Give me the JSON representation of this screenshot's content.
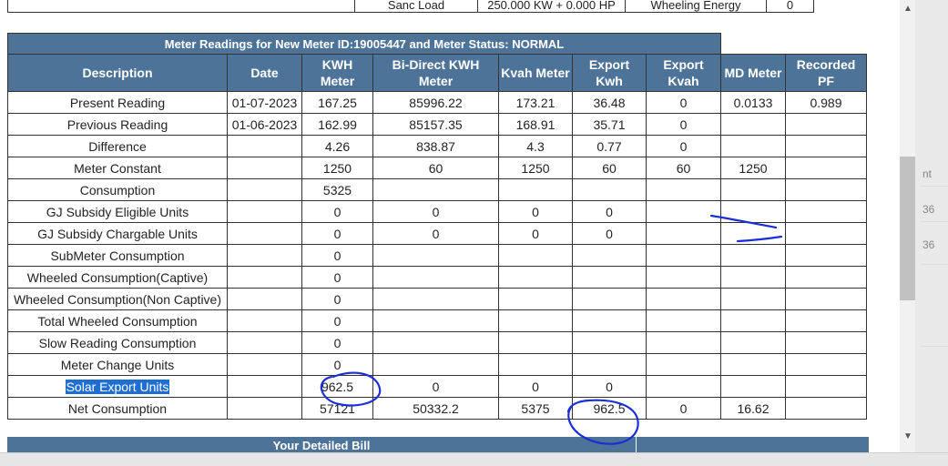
{
  "top_strip": {
    "label1": "Sanc Load",
    "value1": "250.000 KW + 0.000 HP",
    "label2": "Wheeling Energy",
    "value2": "0"
  },
  "readings_table": {
    "title": "Meter Readings for New Meter ID:19005447 and Meter Status: NORMAL",
    "headers": [
      "Description",
      "Date",
      "KWH Meter",
      "Bi-Direct KWH Meter",
      "Kvah Meter",
      "Export Kwh",
      "Export Kvah",
      "MD Meter",
      "Recorded PF"
    ],
    "rows": [
      [
        "Present Reading",
        "01-07-2023",
        "167.25",
        "85996.22",
        "173.21",
        "36.48",
        "0",
        "0.0133",
        "0.989"
      ],
      [
        "Previous Reading",
        "01-06-2023",
        "162.99",
        "85157.35",
        "168.91",
        "35.71",
        "0",
        "",
        ""
      ],
      [
        "Difference",
        "",
        "4.26",
        "838.87",
        "4.3",
        "0.77",
        "0",
        "",
        ""
      ],
      [
        "Meter Constant",
        "",
        "1250",
        "60",
        "1250",
        "60",
        "60",
        "1250",
        ""
      ],
      [
        "Consumption",
        "",
        "5325",
        "",
        "",
        "",
        "",
        "",
        ""
      ],
      [
        "GJ Subsidy Eligible Units",
        "",
        "0",
        "0",
        "0",
        "0",
        "",
        "",
        ""
      ],
      [
        "GJ Subsidy Chargable Units",
        "",
        "0",
        "0",
        "0",
        "0",
        "",
        "",
        ""
      ],
      [
        "SubMeter Consumption",
        "",
        "0",
        "",
        "",
        "",
        "",
        "",
        ""
      ],
      [
        "Wheeled Consumption(Captive)",
        "",
        "0",
        "",
        "",
        "",
        "",
        "",
        ""
      ],
      [
        "Wheeled Consumption(Non Captive)",
        "",
        "0",
        "",
        "",
        "",
        "",
        "",
        ""
      ],
      [
        "Total Wheeled Consumption",
        "",
        "0",
        "",
        "",
        "",
        "",
        "",
        ""
      ],
      [
        "Slow Reading Consumption",
        "",
        "0",
        "",
        "",
        "",
        "",
        "",
        ""
      ],
      [
        "Meter Change Units",
        "",
        "0",
        "",
        "",
        "",
        "",
        "",
        ""
      ],
      [
        "Solar Export Units",
        "",
        "962.5",
        "0",
        "0",
        "0",
        "",
        "",
        ""
      ],
      [
        "Net Consumption",
        "",
        "57121",
        "50332.2",
        "5375",
        "962.5",
        "0",
        "16.62",
        ""
      ]
    ]
  },
  "detailed_bill": {
    "title": "Your Detailed Bill"
  },
  "background_panel": {
    "header": "nt",
    "val1": "36",
    "val2": "36"
  },
  "annotation_color": "#1a2fd6",
  "header_color": "#4e7399",
  "selection_color": "#1e6fd1"
}
